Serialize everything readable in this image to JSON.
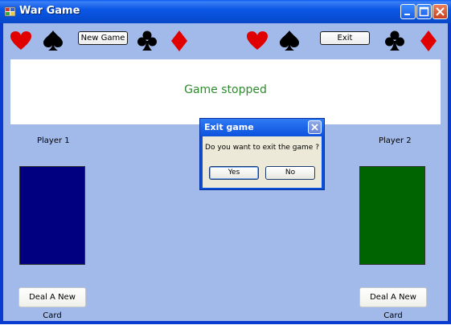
{
  "window": {
    "title": "War Game"
  },
  "toolbar": {
    "new_game_label": "New Game",
    "exit_label": "Exit",
    "suits_left": [
      "heart-icon",
      "spade-icon",
      "club-icon",
      "diamond-icon"
    ],
    "suits_right": [
      "heart-icon",
      "spade-icon",
      "club-icon",
      "diamond-icon"
    ]
  },
  "status": {
    "text": "Game stopped"
  },
  "player1": {
    "label": "Player 1",
    "card_color": "#000080",
    "deal_label": "Deal A New Card"
  },
  "player2": {
    "label": "Player 2",
    "card_color": "#006400",
    "deal_label": "Deal A New Card"
  },
  "dialog": {
    "title": "Exit game",
    "message": "Do you want to exit the game ?",
    "yes_label": "Yes",
    "no_label": "No"
  },
  "colors": {
    "background": "#a2baea",
    "heart": "#e00000",
    "diamond": "#e00000",
    "spade": "#000000",
    "club": "#000000",
    "status_text": "#2f8a2f"
  }
}
